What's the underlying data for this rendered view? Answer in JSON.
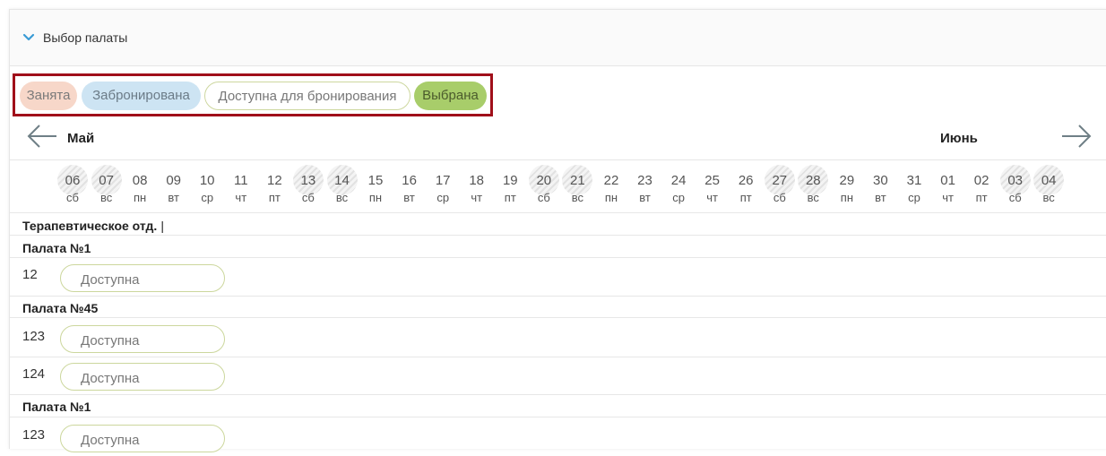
{
  "panel": {
    "title": "Выбор палаты"
  },
  "legend": {
    "busy": "Занята",
    "booked": "Забронирована",
    "available": "Доступна для бронирования",
    "selected": "Выбрана"
  },
  "months": {
    "current": "Май",
    "next": "Июнь"
  },
  "days": [
    {
      "num": "06",
      "dow": "сб",
      "weekend": true
    },
    {
      "num": "07",
      "dow": "вс",
      "weekend": true
    },
    {
      "num": "08",
      "dow": "пн",
      "weekend": false
    },
    {
      "num": "09",
      "dow": "вт",
      "weekend": false
    },
    {
      "num": "10",
      "dow": "ср",
      "weekend": false
    },
    {
      "num": "11",
      "dow": "чт",
      "weekend": false
    },
    {
      "num": "12",
      "dow": "пт",
      "weekend": false
    },
    {
      "num": "13",
      "dow": "сб",
      "weekend": true
    },
    {
      "num": "14",
      "dow": "вс",
      "weekend": true
    },
    {
      "num": "15",
      "dow": "пн",
      "weekend": false
    },
    {
      "num": "16",
      "dow": "вт",
      "weekend": false
    },
    {
      "num": "17",
      "dow": "ср",
      "weekend": false
    },
    {
      "num": "18",
      "dow": "чт",
      "weekend": false
    },
    {
      "num": "19",
      "dow": "пт",
      "weekend": false
    },
    {
      "num": "20",
      "dow": "сб",
      "weekend": true
    },
    {
      "num": "21",
      "dow": "вс",
      "weekend": true
    },
    {
      "num": "22",
      "dow": "пн",
      "weekend": false
    },
    {
      "num": "23",
      "dow": "вт",
      "weekend": false
    },
    {
      "num": "24",
      "dow": "ср",
      "weekend": false
    },
    {
      "num": "25",
      "dow": "чт",
      "weekend": false
    },
    {
      "num": "26",
      "dow": "пт",
      "weekend": false
    },
    {
      "num": "27",
      "dow": "сб",
      "weekend": true
    },
    {
      "num": "28",
      "dow": "вс",
      "weekend": true
    },
    {
      "num": "29",
      "dow": "пн",
      "weekend": false
    },
    {
      "num": "30",
      "dow": "вт",
      "weekend": false
    },
    {
      "num": "31",
      "dow": "ср",
      "weekend": false
    },
    {
      "num": "01",
      "dow": "чт",
      "weekend": false
    },
    {
      "num": "02",
      "dow": "пт",
      "weekend": false
    },
    {
      "num": "03",
      "dow": "сб",
      "weekend": true
    },
    {
      "num": "04",
      "dow": "вс",
      "weekend": true
    }
  ],
  "department": {
    "name": "Терапевтическое отд.",
    "caret": "|"
  },
  "wards": [
    {
      "name": "Палата №1",
      "beds": [
        {
          "number": "12",
          "status": "Доступна"
        }
      ]
    },
    {
      "name": "Палата №45",
      "beds": [
        {
          "number": "123",
          "status": "Доступна"
        },
        {
          "number": "124",
          "status": "Доступна"
        }
      ]
    },
    {
      "name": "Палата №1",
      "beds": [
        {
          "number": "123",
          "status": "Доступна"
        }
      ]
    }
  ],
  "colors": {
    "busy": "#f7d7c9",
    "booked": "#cde4f3",
    "available_border": "#ccd79d",
    "selected": "#a8cd6a",
    "highlight_frame": "#a00f1a",
    "chevron": "#3a9bd5"
  }
}
